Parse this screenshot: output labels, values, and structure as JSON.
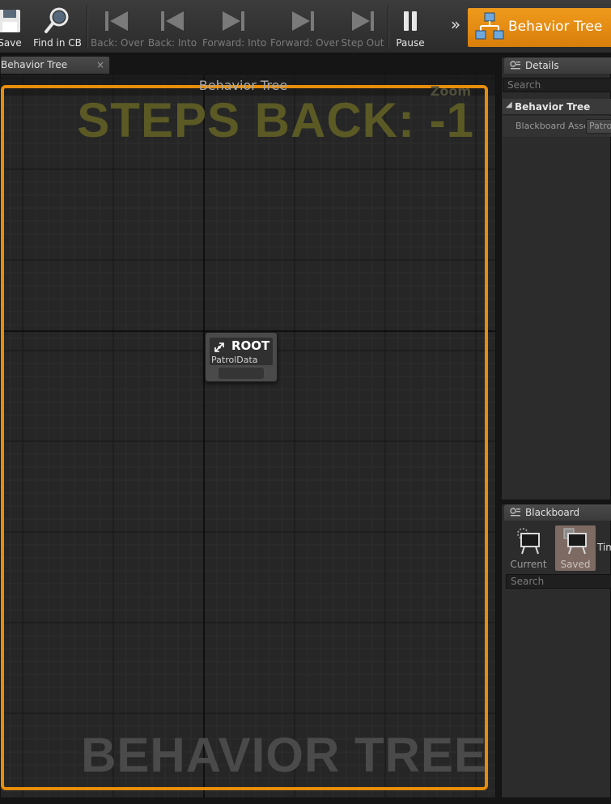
{
  "toolbar": {
    "buttons": [
      {
        "label": "Save",
        "state": "enabled",
        "icon": "floppy-disk-icon"
      },
      {
        "label": "Find in CB",
        "state": "enabled",
        "icon": "magnifier-icon"
      },
      {
        "label": "Back: Over",
        "state": "disabled",
        "icon": "step-back-over-icon"
      },
      {
        "label": "Back: Into",
        "state": "disabled",
        "icon": "step-back-into-icon"
      },
      {
        "label": "Forward: Into",
        "state": "disabled",
        "icon": "step-forward-into-icon"
      },
      {
        "label": "Forward: Over",
        "state": "disabled",
        "icon": "step-forward-over-icon"
      },
      {
        "label": "Step Out",
        "state": "disabled",
        "icon": "step-out-icon"
      },
      {
        "label": "Pause",
        "state": "enabled",
        "icon": "pause-icon"
      }
    ],
    "overflow": "»",
    "mode_tab": {
      "label": "Behavior Tree",
      "icon": "behavior-tree-icon"
    }
  },
  "document_tab": {
    "label": "Behavior Tree",
    "close": "×"
  },
  "graph": {
    "title": "Behavior Tree",
    "zoom_label": "Zoom",
    "steps_back": "STEPS BACK: -1",
    "watermark": "BEHAVIOR TREE",
    "root_node": {
      "title": "ROOT",
      "blackboard": "PatrolData",
      "icon": "root-node-icon"
    }
  },
  "details": {
    "tab_label": "Details",
    "search_placeholder": "Search",
    "category": "Behavior Tree",
    "property_name": "Blackboard Asset",
    "property_value": "PatrolData"
  },
  "blackboard": {
    "tab_label": "Blackboard",
    "current_label": "Current",
    "saved_label": "Saved",
    "time_label": "Time",
    "search_placeholder": "Search"
  },
  "colors": {
    "accent": "#e68d0c",
    "mode_tab": "#ef9a1c",
    "graph_bg": "#262626",
    "steps_back_text": "#5b5a25"
  }
}
